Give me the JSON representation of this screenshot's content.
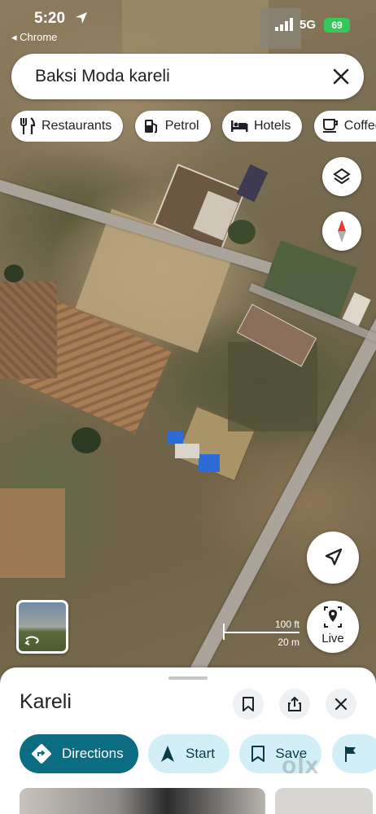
{
  "status_bar": {
    "time": "5:20",
    "back_app": "◂ Chrome",
    "network": "5G",
    "battery": "69"
  },
  "search": {
    "query": "Baksi Moda kareli"
  },
  "categories": [
    "Restaurants",
    "Petrol",
    "Hotels",
    "Coffee"
  ],
  "map": {
    "scale_feet": "100 ft",
    "scale_meters": "20 m",
    "live_label": "Live"
  },
  "place": {
    "title": "Kareli",
    "actions": [
      "Directions",
      "Start",
      "Save"
    ]
  },
  "watermark": "olx",
  "colors": {
    "primary_action": "#0b6c82",
    "secondary_action": "#d2eff8",
    "compass_red": "#e53935",
    "battery": "#35c759"
  }
}
